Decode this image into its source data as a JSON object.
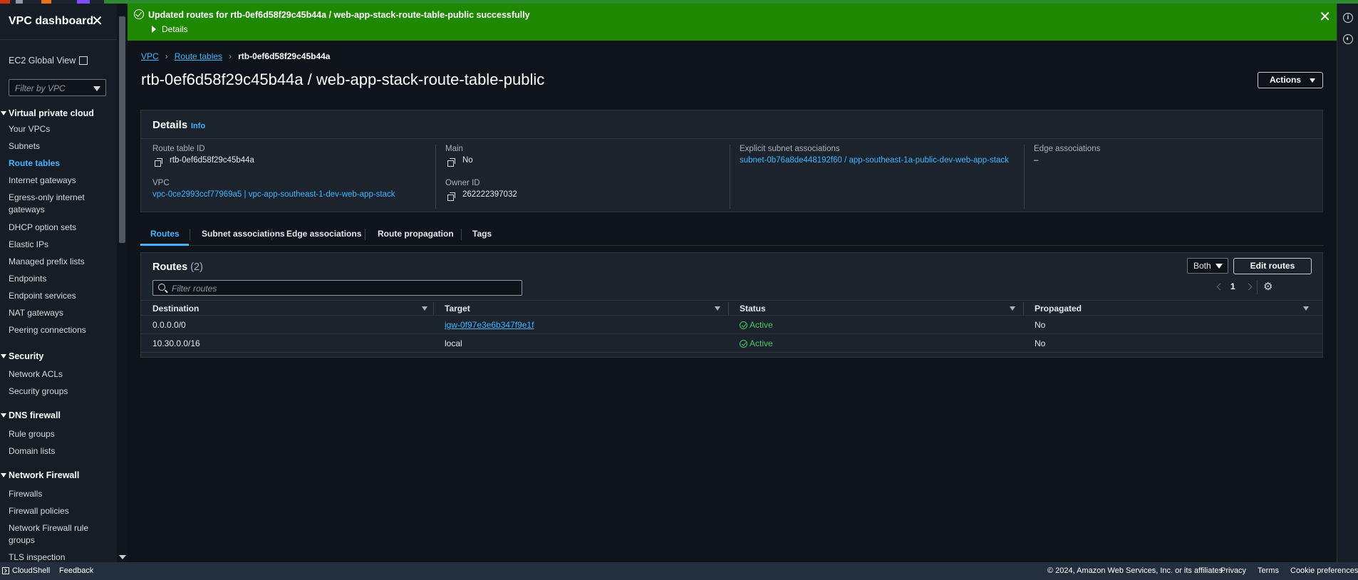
{
  "flash": {
    "message": "Updated routes for rtb-0ef6d58f29c45b44a / web-app-stack-route-table-public successfully",
    "details_label": "Details",
    "color": "#1e8900"
  },
  "sidebar": {
    "title": "VPC dashboard",
    "ec2_global_view": "EC2 Global View",
    "filter_placeholder": "Filter by VPC",
    "sections": [
      {
        "title": "Virtual private cloud",
        "items": [
          "Your VPCs",
          "Subnets",
          "Route tables",
          "Internet gateways",
          "Egress-only internet gateways",
          "DHCP option sets",
          "Elastic IPs",
          "Managed prefix lists",
          "Endpoints",
          "Endpoint services",
          "NAT gateways",
          "Peering connections"
        ]
      },
      {
        "title": "Security",
        "items": [
          "Network ACLs",
          "Security groups"
        ]
      },
      {
        "title": "DNS firewall",
        "items": [
          "Rule groups",
          "Domain lists"
        ]
      },
      {
        "title": "Network Firewall",
        "items": [
          "Firewalls",
          "Firewall policies",
          "Network Firewall rule groups",
          "TLS inspection"
        ]
      }
    ],
    "active_item": "Route tables"
  },
  "breadcrumb": {
    "items": [
      "VPC",
      "Route tables"
    ],
    "current": "rtb-0ef6d58f29c45b44a"
  },
  "page": {
    "title": "rtb-0ef6d58f29c45b44a / web-app-stack-route-table-public",
    "actions_label": "Actions"
  },
  "details": {
    "title": "Details",
    "info": "Info",
    "route_table_id_label": "Route table ID",
    "route_table_id": "rtb-0ef6d58f29c45b44a",
    "vpc_label": "VPC",
    "vpc": "vpc-0ce2993ccf77969a5 | vpc-app-southeast-1-dev-web-app-stack",
    "main_label": "Main",
    "main": "No",
    "owner_id_label": "Owner ID",
    "owner_id": "262222397032",
    "explicit_label": "Explicit subnet associations",
    "explicit": "subnet-0b76a8de448192f60 / app-southeast-1a-public-dev-web-app-stack",
    "edge_label": "Edge associations",
    "edge": "–"
  },
  "tabs": [
    "Routes",
    "Subnet associations",
    "Edge associations",
    "Route propagation",
    "Tags"
  ],
  "routes": {
    "title": "Routes",
    "count": "(2)",
    "filter_select": "Both",
    "edit_label": "Edit routes",
    "filter_placeholder": "Filter routes",
    "page": "1",
    "columns": [
      "Destination",
      "Target",
      "Status",
      "Propagated"
    ],
    "rows": [
      {
        "destination": "0.0.0.0/0",
        "target": "igw-0f97e3e6b347f9e1f",
        "status": "Active",
        "propagated": "No"
      },
      {
        "destination": "10.30.0.0/16",
        "target": "local",
        "status": "Active",
        "propagated": "No"
      }
    ]
  },
  "footer": {
    "cloudshell": "CloudShell",
    "feedback": "Feedback",
    "copyright": "© 2024, Amazon Web Services, Inc. or its affiliates.",
    "privacy": "Privacy",
    "terms": "Terms",
    "cookie": "Cookie preferences"
  },
  "icons": [
    "close-icon",
    "external-link-icon",
    "chevron-down-icon",
    "success-icon",
    "copy-icon",
    "search-icon",
    "gear-icon",
    "info-icon",
    "cloudshell-icon"
  ],
  "colors": {
    "link": "#42b4ff",
    "success": "#46c866",
    "background": "#0f141a"
  }
}
